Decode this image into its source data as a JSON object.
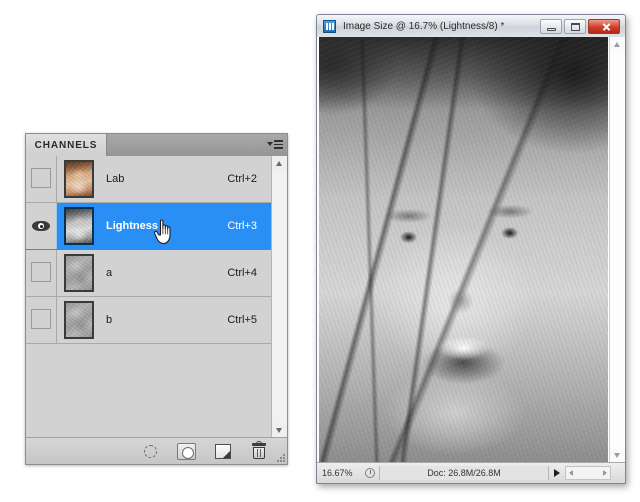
{
  "channels_panel": {
    "tab_label": "CHANNELS",
    "menu_icon": "panel-menu-icon",
    "rows": [
      {
        "name": "Lab",
        "shortcut": "Ctrl+2",
        "visible": false,
        "selected": false,
        "thumb": "color"
      },
      {
        "name": "Lightness",
        "shortcut": "Ctrl+3",
        "visible": true,
        "selected": true,
        "thumb": "gray"
      },
      {
        "name": "a",
        "shortcut": "Ctrl+4",
        "visible": false,
        "selected": false,
        "thumb": "flat"
      },
      {
        "name": "b",
        "shortcut": "Ctrl+5",
        "visible": false,
        "selected": false,
        "thumb": "flat"
      }
    ],
    "footer_icons": [
      "load-channel-as-selection-icon",
      "save-selection-as-channel-icon",
      "create-new-channel-icon",
      "delete-channel-icon"
    ],
    "selection_color": "#2a8ff4",
    "panel_bg_color": "#d2d2d2"
  },
  "image_window": {
    "title": "Image Size @ 16.7% (Lightness/8) *",
    "app_icon": "photoshop-icon",
    "controls": {
      "minimize": "minimize-button",
      "maximize": "maximize-button",
      "close": "close-button"
    },
    "close_color": "#cf3f29",
    "statusbar": {
      "zoom": "16.67%",
      "doc_info": "Doc: 26.8M/26.8M",
      "clock_icon": "clock-icon",
      "expand_icon": "expand-arrow-icon"
    },
    "photo_alt": "black-and-white-portrait-of-smiling-girl"
  },
  "cursor": {
    "type": "pointing-hand-cursor"
  }
}
